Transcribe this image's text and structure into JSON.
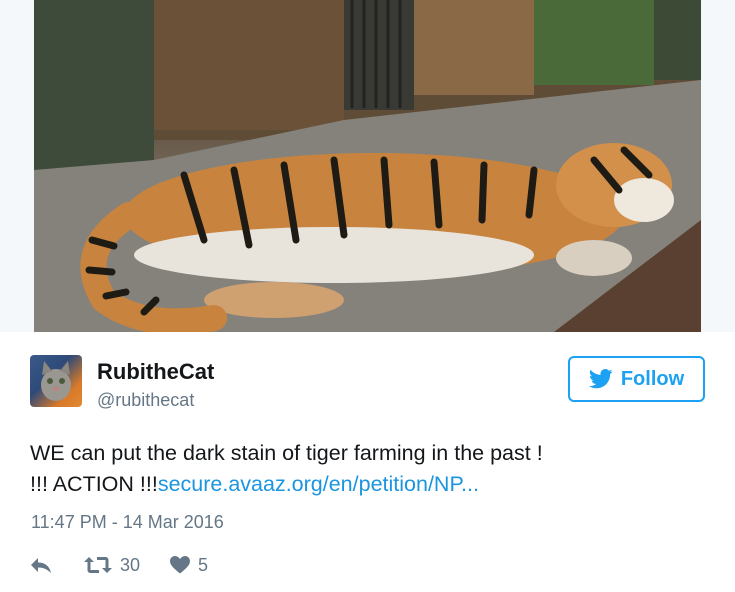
{
  "media": {
    "subject": "photo"
  },
  "author": {
    "display_name": "RubitheCat",
    "handle": "@rubithecat"
  },
  "follow_label": "Follow",
  "tweet": {
    "text_line1": "WE can put the dark stain of tiger farming in the past !",
    "text_line2_prefix": "!!! ACTION !!!",
    "link_text": "secure.avaaz.org/en/petition/NP..."
  },
  "timestamp": "11:47 PM - 14 Mar 2016",
  "actions": {
    "retweet_count": "30",
    "like_count": "5"
  },
  "colors": {
    "accent": "#1da1f2",
    "link": "#1b95e0",
    "secondary_text": "#657786"
  }
}
